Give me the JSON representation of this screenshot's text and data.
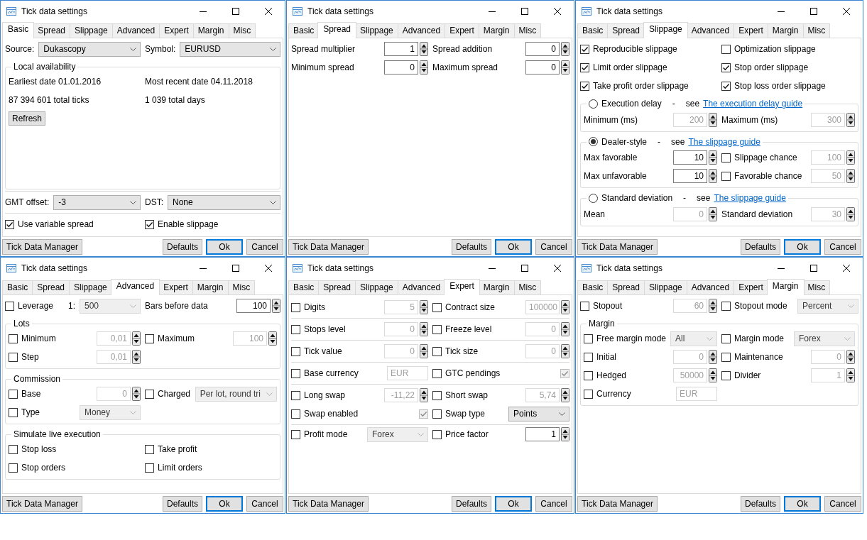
{
  "windows": [
    {
      "title": "Tick data settings",
      "tabs": [
        {
          "label": "Basic",
          "selected": true
        },
        {
          "label": "Spread",
          "selected": false
        },
        {
          "label": "Slippage",
          "selected": false
        },
        {
          "label": "Advanced",
          "selected": false
        },
        {
          "label": "Expert",
          "selected": false
        },
        {
          "label": "Margin",
          "selected": false
        },
        {
          "label": "Misc",
          "selected": false
        }
      ],
      "blocks": [
        {
          "kind": "fields",
          "rows": [
            {
              "left": [
                {
                  "kind": "label",
                  "text": "Source:"
                },
                {
                  "kind": "combo",
                  "value": "Dukascopy",
                  "disabled": false
                }
              ],
              "right": [
                {
                  "kind": "label",
                  "text": "Symbol:"
                },
                {
                  "kind": "combo",
                  "value": "EURUSD",
                  "disabled": false
                }
              ]
            }
          ]
        },
        {
          "kind": "group",
          "title": "Local availability",
          "rows": [
            {
              "left": [
                {
                  "kind": "note",
                  "text": "Earliest date 01.01.2016"
                }
              ],
              "right": [
                {
                  "kind": "note",
                  "text": "Most recent date 04.11.2018"
                }
              ]
            },
            {
              "left": [
                {
                  "kind": "note",
                  "text": "87 394 601 total ticks"
                }
              ],
              "right": [
                {
                  "kind": "note",
                  "text": "1 039 total days"
                }
              ]
            },
            {
              "left": [
                {
                  "kind": "button",
                  "label": "Refresh"
                }
              ]
            }
          ]
        }
      ],
      "bottom": [
        {
          "kind": "fields",
          "rows": [
            {
              "left": [
                {
                  "kind": "label",
                  "text": "GMT offset:"
                },
                {
                  "kind": "combo",
                  "value": "-3",
                  "disabled": false
                }
              ],
              "right": [
                {
                  "kind": "label",
                  "text": "DST:"
                },
                {
                  "kind": "combo",
                  "value": "None",
                  "disabled": false
                }
              ]
            }
          ]
        },
        {
          "kind": "grid",
          "rows": [
            {
              "left": [
                {
                  "kind": "check",
                  "label": "Use variable spread",
                  "checked": true,
                  "disabled": false
                }
              ],
              "right": [
                {
                  "kind": "check",
                  "label": "Enable slippage",
                  "checked": true,
                  "disabled": false
                }
              ]
            }
          ]
        }
      ],
      "footer": {
        "left": [
          {
            "label": "Tick Data Manager",
            "default": false
          }
        ],
        "right": [
          {
            "label": "Defaults",
            "default": false
          },
          {
            "label": "Ok",
            "default": true
          },
          {
            "label": "Cancel",
            "default": false
          }
        ]
      }
    },
    {
      "title": "Tick data settings",
      "tabs": [
        {
          "label": "Basic",
          "selected": false
        },
        {
          "label": "Spread",
          "selected": true
        },
        {
          "label": "Slippage",
          "selected": false
        },
        {
          "label": "Advanced",
          "selected": false
        },
        {
          "label": "Expert",
          "selected": false
        },
        {
          "label": "Margin",
          "selected": false
        },
        {
          "label": "Misc",
          "selected": false
        }
      ],
      "blocks": [
        {
          "kind": "grid",
          "rows": [
            {
              "left": [
                {
                  "kind": "label",
                  "text": "Spread multiplier"
                },
                {
                  "kind": "spin",
                  "value": "1",
                  "disabled": false
                }
              ],
              "right": [
                {
                  "kind": "label",
                  "text": "Spread addition"
                },
                {
                  "kind": "spin",
                  "value": "0",
                  "disabled": false
                }
              ]
            },
            {
              "left": [
                {
                  "kind": "label",
                  "text": "Minimum spread"
                },
                {
                  "kind": "spin",
                  "value": "0",
                  "disabled": false
                }
              ],
              "right": [
                {
                  "kind": "label",
                  "text": "Maximum spread"
                },
                {
                  "kind": "spin",
                  "value": "0",
                  "disabled": false
                }
              ]
            }
          ]
        }
      ],
      "footer": {
        "left": [
          {
            "label": "Tick Data Manager",
            "default": false
          }
        ],
        "right": [
          {
            "label": "Defaults",
            "default": false
          },
          {
            "label": "Ok",
            "default": true
          },
          {
            "label": "Cancel",
            "default": false
          }
        ]
      }
    },
    {
      "title": "Tick data settings",
      "tabs": [
        {
          "label": "Basic",
          "selected": false
        },
        {
          "label": "Spread",
          "selected": false
        },
        {
          "label": "Slippage",
          "selected": true
        },
        {
          "label": "Advanced",
          "selected": false
        },
        {
          "label": "Expert",
          "selected": false
        },
        {
          "label": "Margin",
          "selected": false
        },
        {
          "label": "Misc",
          "selected": false
        }
      ],
      "blocks": [
        {
          "kind": "grid",
          "rows": [
            {
              "left": [
                {
                  "kind": "check",
                  "label": "Reproducible slippage",
                  "checked": true,
                  "disabled": false
                }
              ],
              "right": [
                {
                  "kind": "check",
                  "label": "Optimization slippage",
                  "checked": false,
                  "disabled": false
                }
              ]
            },
            {
              "left": [
                {
                  "kind": "check",
                  "label": "Limit order slippage",
                  "checked": true,
                  "disabled": false
                }
              ],
              "right": [
                {
                  "kind": "check",
                  "label": "Stop order slippage",
                  "checked": true,
                  "disabled": false
                }
              ]
            },
            {
              "left": [
                {
                  "kind": "check",
                  "label": "Take profit order slippage",
                  "checked": true,
                  "disabled": false
                }
              ],
              "right": [
                {
                  "kind": "check",
                  "label": "Stop loss order slippage",
                  "checked": true,
                  "disabled": false
                }
              ]
            }
          ]
        },
        {
          "kind": "group",
          "radio": {
            "label": "Execution delay",
            "selected": false
          },
          "dash": "-",
          "see": "see",
          "link": "The execution delay guide",
          "rows": [
            {
              "left": [
                {
                  "kind": "label",
                  "text": "Minimum (ms)"
                },
                {
                  "kind": "spin",
                  "value": "200",
                  "disabled": true
                }
              ],
              "right": [
                {
                  "kind": "label",
                  "text": "Maximum (ms)"
                },
                {
                  "kind": "spin",
                  "value": "300",
                  "disabled": true
                }
              ]
            }
          ]
        },
        {
          "kind": "group",
          "radio": {
            "label": "Dealer-style",
            "selected": true
          },
          "dash": "-",
          "see": "see",
          "link": "The slippage guide",
          "rows": [
            {
              "left": [
                {
                  "kind": "label",
                  "text": "Max favorable"
                },
                {
                  "kind": "spin",
                  "value": "10",
                  "disabled": false
                }
              ],
              "right": [
                {
                  "kind": "check",
                  "label": "Slippage chance",
                  "checked": false,
                  "disabled": false
                },
                {
                  "kind": "spin",
                  "value": "100",
                  "disabled": true
                }
              ]
            },
            {
              "left": [
                {
                  "kind": "label",
                  "text": "Max unfavorable"
                },
                {
                  "kind": "spin",
                  "value": "10",
                  "disabled": false
                }
              ],
              "right": [
                {
                  "kind": "check",
                  "label": "Favorable chance",
                  "checked": false,
                  "disabled": false
                },
                {
                  "kind": "spin",
                  "value": "50",
                  "disabled": true
                }
              ]
            }
          ]
        },
        {
          "kind": "group",
          "radio": {
            "label": "Standard deviation",
            "selected": false
          },
          "dash": "-",
          "see": "see",
          "link": "The slippage guide",
          "rows": [
            {
              "left": [
                {
                  "kind": "label",
                  "text": "Mean"
                },
                {
                  "kind": "spin",
                  "value": "0",
                  "disabled": true
                }
              ],
              "right": [
                {
                  "kind": "label",
                  "text": "Standard deviation"
                },
                {
                  "kind": "spin",
                  "value": "30",
                  "disabled": true
                }
              ]
            }
          ]
        }
      ],
      "footer": {
        "left": [
          {
            "label": "Tick Data Manager",
            "default": false
          }
        ],
        "right": [
          {
            "label": "Defaults",
            "default": false
          },
          {
            "label": "Ok",
            "default": true
          },
          {
            "label": "Cancel",
            "default": false
          }
        ]
      }
    },
    {
      "title": "Tick data settings",
      "tabs": [
        {
          "label": "Basic",
          "selected": false
        },
        {
          "label": "Spread",
          "selected": false
        },
        {
          "label": "Slippage",
          "selected": false
        },
        {
          "label": "Advanced",
          "selected": true
        },
        {
          "label": "Expert",
          "selected": false
        },
        {
          "label": "Margin",
          "selected": false
        },
        {
          "label": "Misc",
          "selected": false
        }
      ],
      "blocks": [
        {
          "kind": "grid",
          "rows": [
            {
              "left": [
                {
                  "kind": "check",
                  "label": "Leverage",
                  "checked": false,
                  "disabled": false
                },
                {
                  "kind": "label",
                  "text": "1:"
                },
                {
                  "kind": "combo",
                  "value": "500",
                  "disabled": true
                }
              ],
              "right": [
                {
                  "kind": "label",
                  "text": "Bars before data"
                },
                {
                  "kind": "spin",
                  "value": "100",
                  "disabled": false
                }
              ]
            }
          ]
        },
        {
          "kind": "group",
          "title": "Lots",
          "rows": [
            {
              "left": [
                {
                  "kind": "check",
                  "label": "Minimum",
                  "checked": false,
                  "disabled": false
                },
                {
                  "kind": "spin",
                  "value": "0,01",
                  "disabled": true
                }
              ],
              "right": [
                {
                  "kind": "check",
                  "label": "Maximum",
                  "checked": false,
                  "disabled": false
                },
                {
                  "kind": "spin",
                  "value": "100",
                  "disabled": true
                }
              ]
            },
            {
              "left": [
                {
                  "kind": "check",
                  "label": "Step",
                  "checked": false,
                  "disabled": false
                },
                {
                  "kind": "spin",
                  "value": "0,01",
                  "disabled": true
                }
              ]
            }
          ]
        },
        {
          "kind": "group",
          "title": "Commission",
          "rows": [
            {
              "left": [
                {
                  "kind": "check",
                  "label": "Base",
                  "checked": false,
                  "disabled": false
                },
                {
                  "kind": "spin",
                  "value": "0",
                  "disabled": true
                }
              ],
              "right": [
                {
                  "kind": "check",
                  "label": "Charged",
                  "checked": false,
                  "disabled": false
                },
                {
                  "kind": "combo",
                  "value": "Per lot, round tri",
                  "disabled": true
                }
              ]
            },
            {
              "left": [
                {
                  "kind": "check",
                  "label": "Type",
                  "checked": false,
                  "disabled": false
                },
                {
                  "kind": "combo",
                  "value": "Money",
                  "disabled": true
                }
              ]
            }
          ]
        },
        {
          "kind": "group",
          "title": "Simulate live execution",
          "rows": [
            {
              "left": [
                {
                  "kind": "check",
                  "label": "Stop loss",
                  "checked": false,
                  "disabled": false
                }
              ],
              "right": [
                {
                  "kind": "check",
                  "label": "Take profit",
                  "checked": false,
                  "disabled": false
                }
              ]
            },
            {
              "left": [
                {
                  "kind": "check",
                  "label": "Stop orders",
                  "checked": false,
                  "disabled": false
                }
              ],
              "right": [
                {
                  "kind": "check",
                  "label": "Limit orders",
                  "checked": false,
                  "disabled": false
                }
              ]
            }
          ]
        }
      ],
      "footer": {
        "left": [
          {
            "label": "Tick Data Manager",
            "default": false
          }
        ],
        "right": [
          {
            "label": "Defaults",
            "default": false
          },
          {
            "label": "Ok",
            "default": true
          },
          {
            "label": "Cancel",
            "default": false
          }
        ]
      }
    },
    {
      "title": "Tick data settings",
      "tabs": [
        {
          "label": "Basic",
          "selected": false
        },
        {
          "label": "Spread",
          "selected": false
        },
        {
          "label": "Slippage",
          "selected": false
        },
        {
          "label": "Advanced",
          "selected": false
        },
        {
          "label": "Expert",
          "selected": true
        },
        {
          "label": "Margin",
          "selected": false
        },
        {
          "label": "Misc",
          "selected": false
        }
      ],
      "blocks": [
        {
          "kind": "band",
          "rows": [
            {
              "left": [
                {
                  "kind": "check",
                  "label": "Digits",
                  "checked": false,
                  "disabled": false
                },
                {
                  "kind": "spin",
                  "value": "5",
                  "disabled": true
                }
              ],
              "right": [
                {
                  "kind": "check",
                  "label": "Contract size",
                  "checked": false,
                  "disabled": false
                },
                {
                  "kind": "spin",
                  "value": "100000",
                  "disabled": true
                }
              ]
            }
          ]
        },
        {
          "kind": "band",
          "rows": [
            {
              "left": [
                {
                  "kind": "check",
                  "label": "Stops level",
                  "checked": false,
                  "disabled": false
                },
                {
                  "kind": "spin",
                  "value": "0",
                  "disabled": true
                }
              ],
              "right": [
                {
                  "kind": "check",
                  "label": "Freeze level",
                  "checked": false,
                  "disabled": false
                },
                {
                  "kind": "spin",
                  "value": "0",
                  "disabled": true
                }
              ]
            }
          ]
        },
        {
          "kind": "band",
          "rows": [
            {
              "left": [
                {
                  "kind": "check",
                  "label": "Tick value",
                  "checked": false,
                  "disabled": false
                },
                {
                  "kind": "spin",
                  "value": "0",
                  "disabled": true
                }
              ],
              "right": [
                {
                  "kind": "check",
                  "label": "Tick size",
                  "checked": false,
                  "disabled": false
                },
                {
                  "kind": "spin",
                  "value": "0",
                  "disabled": true
                }
              ]
            }
          ]
        },
        {
          "kind": "band",
          "rows": [
            {
              "left": [
                {
                  "kind": "check",
                  "label": "Base currency",
                  "checked": false,
                  "disabled": false
                },
                {
                  "kind": "input",
                  "value": "EUR",
                  "disabled": true
                }
              ],
              "right": [
                {
                  "kind": "check",
                  "label": "GTC pendings",
                  "checked": false,
                  "disabled": false
                },
                {
                  "kind": "check",
                  "checked": true,
                  "disabled": true
                }
              ]
            }
          ]
        },
        {
          "kind": "band",
          "rows": [
            {
              "left": [
                {
                  "kind": "check",
                  "label": "Long swap",
                  "checked": false,
                  "disabled": false
                },
                {
                  "kind": "spin",
                  "value": "-11,22",
                  "disabled": true
                }
              ],
              "right": [
                {
                  "kind": "check",
                  "label": "Short swap",
                  "checked": false,
                  "disabled": false
                },
                {
                  "kind": "spin",
                  "value": "5,74",
                  "disabled": true
                }
              ]
            },
            {
              "left": [
                {
                  "kind": "check",
                  "label": "Swap enabled",
                  "checked": false,
                  "disabled": false
                },
                {
                  "kind": "check",
                  "checked": true,
                  "disabled": true
                }
              ],
              "right": [
                {
                  "kind": "check",
                  "label": "Swap type",
                  "checked": false,
                  "disabled": false
                },
                {
                  "kind": "combo",
                  "value": "Points",
                  "disabled": false
                }
              ]
            }
          ]
        },
        {
          "kind": "grid",
          "rows": [
            {
              "left": [
                {
                  "kind": "check",
                  "label": "Profit mode",
                  "checked": false,
                  "disabled": false
                },
                {
                  "kind": "combo",
                  "value": "Forex",
                  "disabled": true
                }
              ],
              "right": [
                {
                  "kind": "check",
                  "label": "Price factor",
                  "checked": false,
                  "disabled": false
                },
                {
                  "kind": "spin",
                  "value": "1",
                  "disabled": false
                }
              ]
            }
          ]
        }
      ],
      "footer": {
        "left": [
          {
            "label": "Tick Data Manager",
            "default": false
          }
        ],
        "right": [
          {
            "label": "Defaults",
            "default": false
          },
          {
            "label": "Ok",
            "default": true
          },
          {
            "label": "Cancel",
            "default": false
          }
        ]
      }
    },
    {
      "title": "Tick data settings",
      "tabs": [
        {
          "label": "Basic",
          "selected": false
        },
        {
          "label": "Spread",
          "selected": false
        },
        {
          "label": "Slippage",
          "selected": false
        },
        {
          "label": "Advanced",
          "selected": false
        },
        {
          "label": "Expert",
          "selected": false
        },
        {
          "label": "Margin",
          "selected": true
        },
        {
          "label": "Misc",
          "selected": false
        }
      ],
      "blocks": [
        {
          "kind": "grid",
          "rows": [
            {
              "left": [
                {
                  "kind": "check",
                  "label": "Stopout",
                  "checked": false,
                  "disabled": false
                },
                {
                  "kind": "spin",
                  "value": "60",
                  "disabled": true
                }
              ],
              "right": [
                {
                  "kind": "check",
                  "label": "Stopout mode",
                  "checked": false,
                  "disabled": false
                },
                {
                  "kind": "combo",
                  "value": "Percent",
                  "disabled": true
                }
              ]
            }
          ]
        },
        {
          "kind": "group",
          "title": "Margin",
          "rows": [
            {
              "left": [
                {
                  "kind": "check",
                  "label": "Free margin mode",
                  "checked": false,
                  "disabled": false
                },
                {
                  "kind": "combo",
                  "value": "All",
                  "disabled": true
                }
              ],
              "right": [
                {
                  "kind": "check",
                  "label": "Margin mode",
                  "checked": false,
                  "disabled": false
                },
                {
                  "kind": "combo",
                  "value": "Forex",
                  "disabled": true
                }
              ]
            },
            {
              "left": [
                {
                  "kind": "check",
                  "label": "Initial",
                  "checked": false,
                  "disabled": false
                },
                {
                  "kind": "spin",
                  "value": "0",
                  "disabled": true
                }
              ],
              "right": [
                {
                  "kind": "check",
                  "label": "Maintenance",
                  "checked": false,
                  "disabled": false
                },
                {
                  "kind": "spin",
                  "value": "0",
                  "disabled": true
                }
              ]
            },
            {
              "left": [
                {
                  "kind": "check",
                  "label": "Hedged",
                  "checked": false,
                  "disabled": false
                },
                {
                  "kind": "spin",
                  "value": "50000",
                  "disabled": true
                }
              ],
              "right": [
                {
                  "kind": "check",
                  "label": "Divider",
                  "checked": false,
                  "disabled": false
                },
                {
                  "kind": "spin",
                  "value": "1",
                  "disabled": true
                }
              ]
            },
            {
              "left": [
                {
                  "kind": "check",
                  "label": "Currency",
                  "checked": false,
                  "disabled": false
                },
                {
                  "kind": "input",
                  "value": "EUR",
                  "disabled": true
                }
              ]
            }
          ]
        }
      ],
      "footer": {
        "left": [
          {
            "label": "Tick Data Manager",
            "default": false
          }
        ],
        "right": [
          {
            "label": "Defaults",
            "default": false
          },
          {
            "label": "Ok",
            "default": true
          },
          {
            "label": "Cancel",
            "default": false
          }
        ]
      }
    }
  ]
}
